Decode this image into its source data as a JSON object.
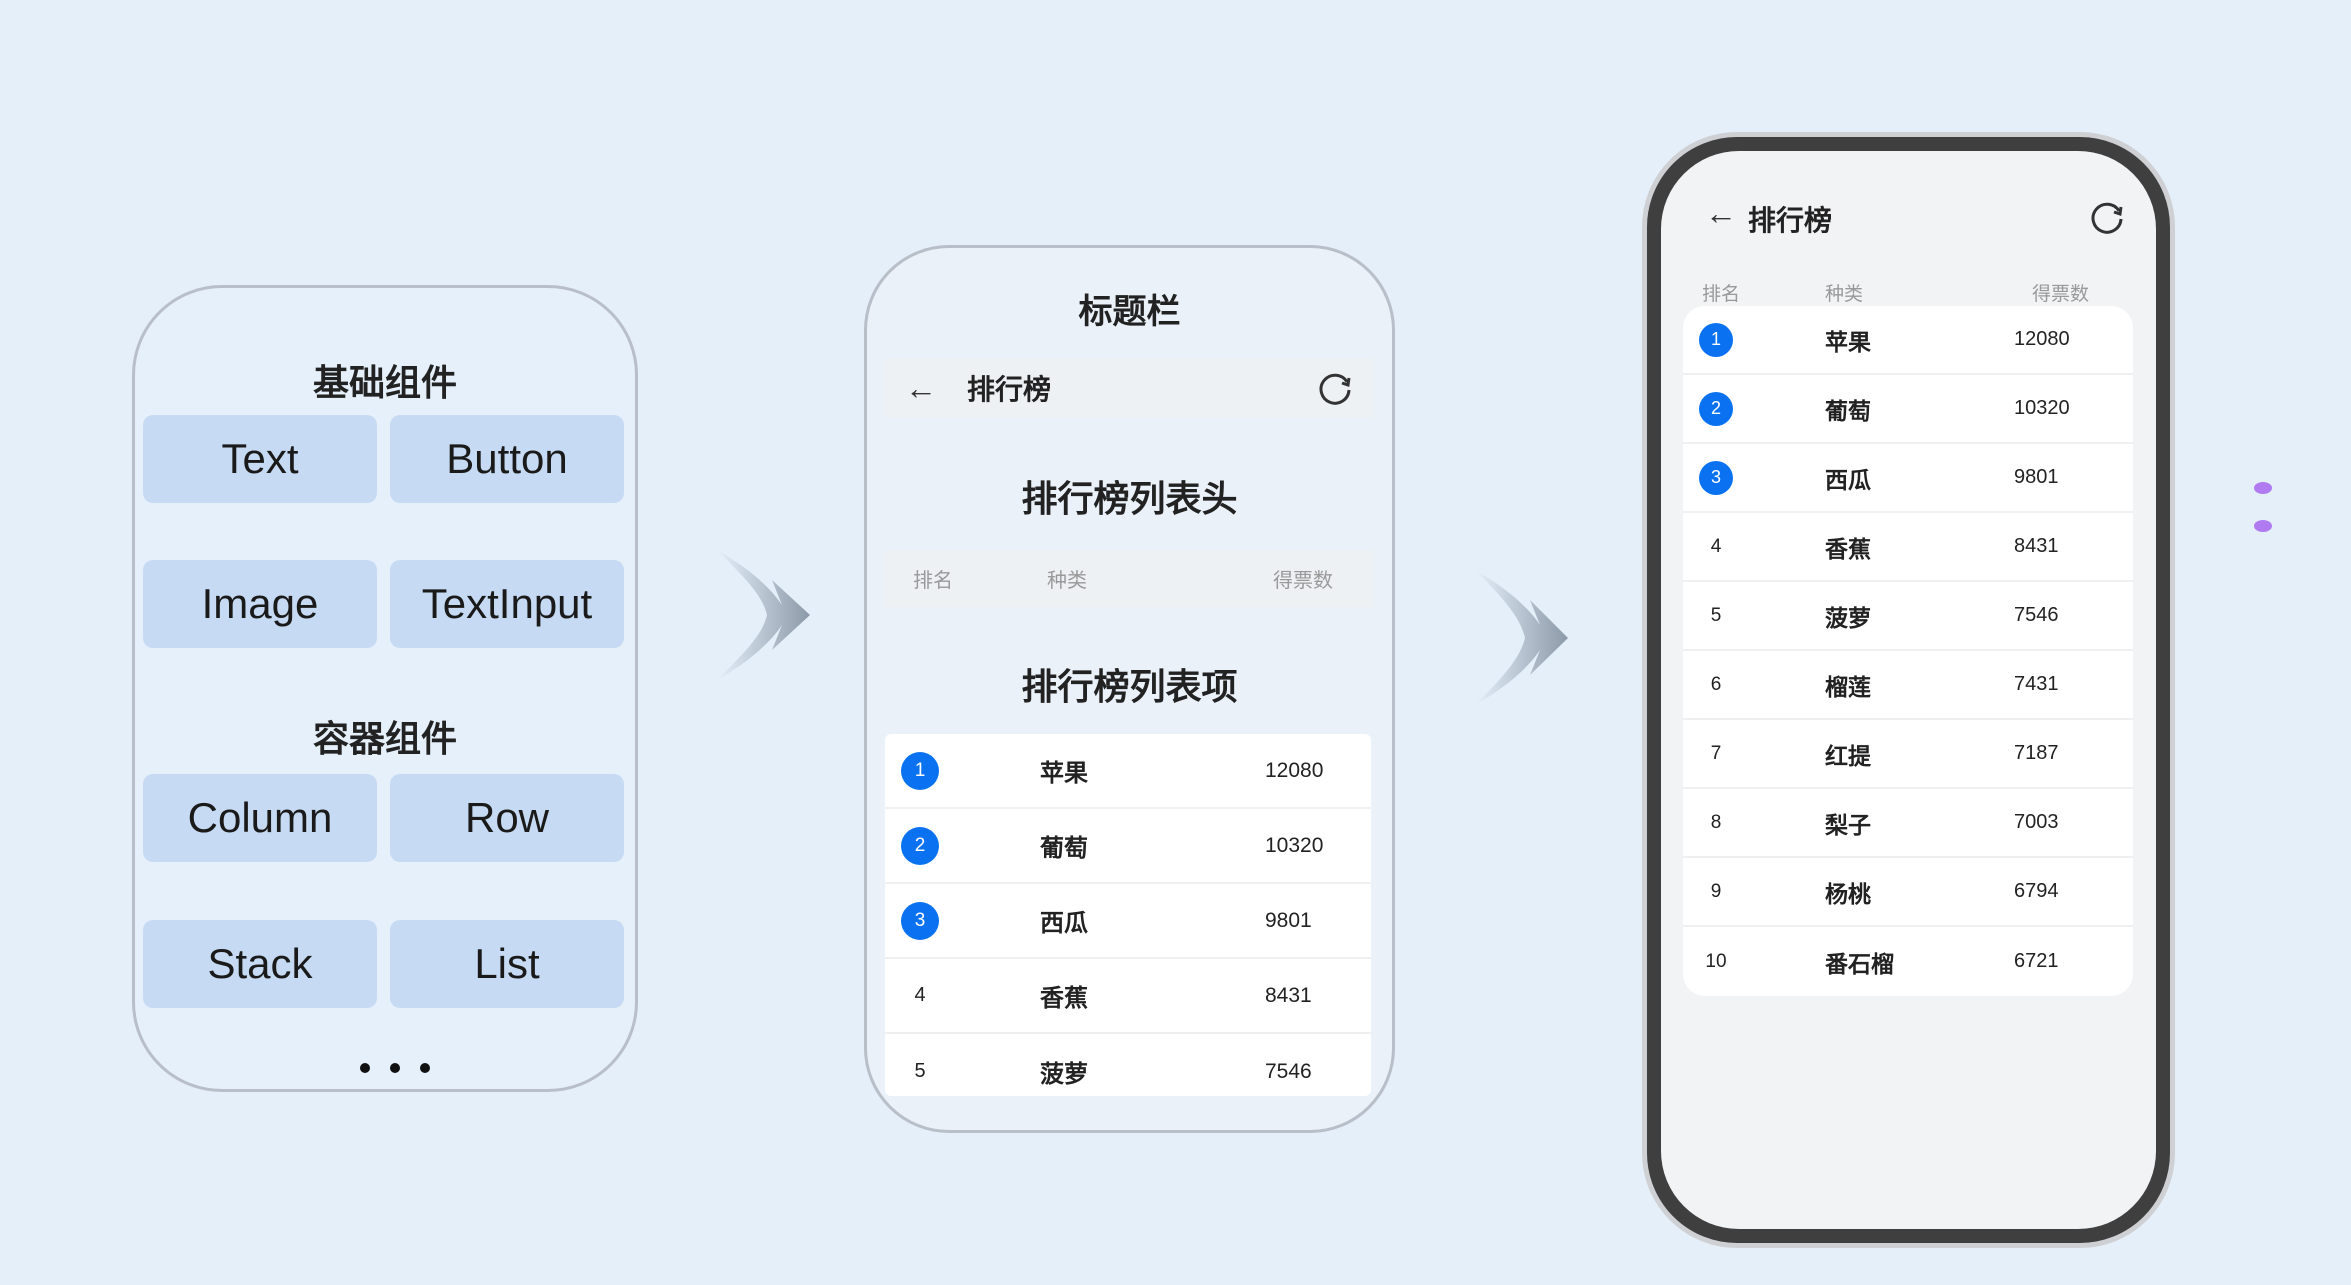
{
  "basic": {
    "title": "基础组件",
    "items": [
      "Text",
      "Button",
      "Image",
      "TextInput"
    ]
  },
  "container": {
    "title": "容器组件",
    "items": [
      "Column",
      "Row",
      "Stack",
      "List"
    ]
  },
  "middle": {
    "title_bar_label": "标题栏",
    "app_title": "排行榜",
    "header_label": "排行榜列表头",
    "items_label": "排行榜列表项",
    "columns": [
      "排名",
      "种类",
      "得票数"
    ],
    "rows": [
      [
        "1",
        "苹果",
        "12080"
      ],
      [
        "2",
        "葡萄",
        "10320"
      ],
      [
        "3",
        "西瓜",
        "9801"
      ],
      [
        "4",
        "香蕉",
        "8431"
      ],
      [
        "5",
        "菠萝",
        "7546"
      ]
    ]
  },
  "right": {
    "app_title": "排行榜",
    "columns": [
      "排名",
      "种类",
      "得票数"
    ],
    "rows": [
      [
        "1",
        "苹果",
        "12080"
      ],
      [
        "2",
        "葡萄",
        "10320"
      ],
      [
        "3",
        "西瓜",
        "9801"
      ],
      [
        "4",
        "香蕉",
        "8431"
      ],
      [
        "5",
        "菠萝",
        "7546"
      ],
      [
        "6",
        "榴莲",
        "7431"
      ],
      [
        "7",
        "红提",
        "7187"
      ],
      [
        "8",
        "梨子",
        "7003"
      ],
      [
        "9",
        "杨桃",
        "6794"
      ],
      [
        "10",
        "番石榴",
        "6721"
      ]
    ]
  },
  "colors": {
    "accent": "#0a72f0",
    "background": "#e4eff9",
    "component_fill": "#c6dbf3"
  },
  "icons": [
    "back-arrow-icon",
    "refresh-icon",
    "flow-arrow-icon"
  ]
}
